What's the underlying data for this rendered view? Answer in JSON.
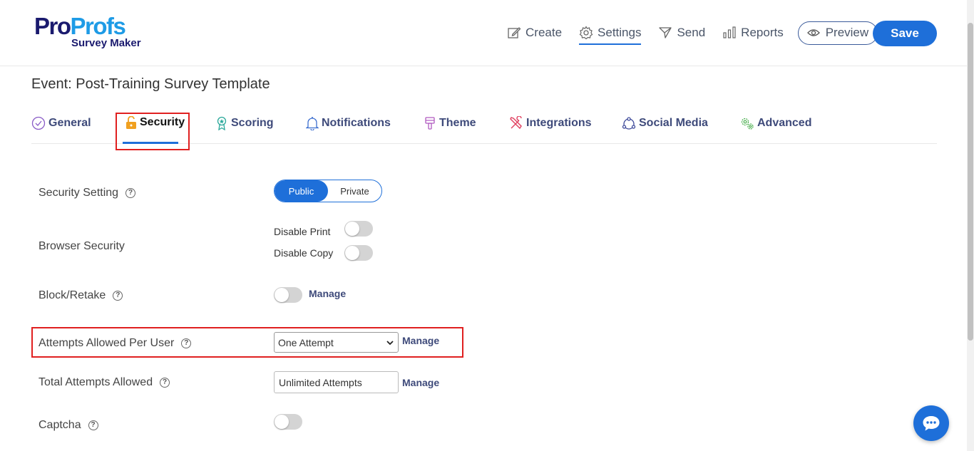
{
  "logo": {
    "part1": "Pro",
    "part2": "Profs",
    "subtitle": "Survey Maker"
  },
  "topnav": {
    "create": "Create",
    "settings": "Settings",
    "send": "Send",
    "reports": "Reports",
    "preview": "Preview",
    "save": "Save"
  },
  "event_title": "Event: Post-Training Survey Template",
  "tabs": {
    "general": "General",
    "security": "Security",
    "scoring": "Scoring",
    "notifications": "Notifications",
    "theme": "Theme",
    "integrations": "Integrations",
    "social_media": "Social Media",
    "advanced": "Advanced"
  },
  "settings": {
    "security_setting": {
      "label": "Security Setting",
      "options": [
        "Public",
        "Private"
      ],
      "selected": "Public"
    },
    "browser_security": {
      "label": "Browser Security",
      "disable_print": "Disable Print",
      "disable_copy": "Disable Copy"
    },
    "block_retake": {
      "label": "Block/Retake",
      "manage": "Manage"
    },
    "attempts_per_user": {
      "label": "Attempts Allowed Per User",
      "value": "One Attempt",
      "manage": "Manage"
    },
    "total_attempts": {
      "label": "Total Attempts Allowed",
      "value": "Unlimited Attempts",
      "manage": "Manage"
    },
    "captcha": {
      "label": "Captcha"
    }
  },
  "help_glyph": "?",
  "colors": {
    "primary": "#1e6fd9",
    "highlight": "#e02020",
    "tab_text": "#3e4a7a"
  }
}
